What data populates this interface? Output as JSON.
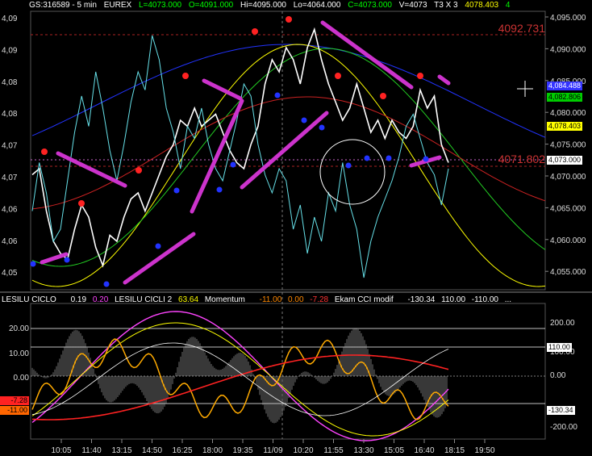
{
  "header": {
    "symbol": "GS:316589 - 5 min",
    "exchange": "EUREX",
    "last": "L=4073.000",
    "open": "O=4091.000",
    "high": "Hi=4095.000",
    "low": "Lo=4064.000",
    "close": "C=4073.000",
    "volume": "V=4073",
    "tx": "T3 X 3",
    "val": "4078.403",
    "num": "4"
  },
  "colors": {
    "up": "#00ff00",
    "hdr_yellow": "#ffff00",
    "price": "#ffffff",
    "cyan": "#66e0e8",
    "magenta": "#cc33cc",
    "accent_red": "#ff2222"
  },
  "price_axis": {
    "left_ticks": [
      "4,09",
      "4,09",
      "4,08",
      "4,08",
      "4,07",
      "4,07",
      "4,06",
      "4,06",
      "4,05"
    ],
    "right_ticks": [
      "4,095.000",
      "4,090.000",
      "4,085.000",
      "4,080.000",
      "4,075.000",
      "4,070.000",
      "4,065.000",
      "4,060.000",
      "4,055.000"
    ]
  },
  "levels": {
    "upper": "4092.731",
    "lower": "4071.802"
  },
  "price_tags": {
    "blue": "4,084.488",
    "green": "4,082.806",
    "yellow": "4,078.403",
    "white": "4,073.000"
  },
  "indicator_header": {
    "l1": "LESILU CICLO",
    "v1": "0.19",
    "v2": "0.20",
    "l2": "LESILU CICLI 2",
    "v3": "63.64",
    "l3": "Momentum",
    "v4": "-11.00",
    "v5": "0.00",
    "v6": "-7.28",
    "l4": "Ekam CCI modif",
    "v7": "-130.34",
    "v8": "110.00",
    "v9": "-110.00",
    "dots": "..."
  },
  "indicator_axis": {
    "left_ticks": [
      "20.00",
      "10.00",
      "0.00"
    ],
    "right_ticks": [
      "200.00",
      "100.00",
      "0.00",
      "-200.00"
    ]
  },
  "indicator_tags": {
    "left_red": "-7.28",
    "left_red2": "-11.00",
    "white1": "110.00",
    "white2": "-130.34"
  },
  "time_axis": [
    "10:05",
    "11:40",
    "13:15",
    "14:50",
    "16:25",
    "18:00",
    "19:35",
    "11/09",
    "10:20",
    "11:55",
    "13:30",
    "15:05",
    "16:40",
    "18:15",
    "19:50"
  ],
  "chart_data": {
    "type": "line",
    "title": "GS:316589 - 5 min",
    "x": [
      0,
      1,
      2,
      3,
      4,
      5,
      6,
      7,
      8,
      9,
      10,
      11,
      12,
      13,
      14,
      15,
      16,
      17,
      18,
      19,
      20,
      21,
      22,
      23,
      24,
      25,
      26,
      27,
      28,
      29,
      30,
      31,
      32,
      33,
      34,
      35,
      36,
      37,
      38,
      39,
      40,
      41,
      42,
      43,
      44,
      45,
      46,
      47,
      48,
      49,
      50,
      51,
      52,
      53,
      54,
      55,
      56,
      57,
      58,
      59
    ],
    "series": [
      {
        "name": "price",
        "values": [
          4071,
          4072,
          4065,
          4060,
          4058,
          4057,
          4062,
          4066,
          4064,
          4059,
          4056,
          4061,
          4060,
          4064,
          4067,
          4068,
          4065,
          4068,
          4071,
          4074,
          4076,
          4080,
          4079,
          4082,
          4079,
          4080,
          4081,
          4078,
          4075,
          4073,
          4072,
          4076,
          4079,
          4086,
          4090,
          4088,
          4092,
          4090,
          4086,
          4092,
          4095,
          4090,
          4086,
          4083,
          4080,
          4082,
          4086,
          4082,
          4078,
          4080,
          4077,
          4080,
          4078,
          4077,
          4079,
          4085,
          4082,
          4084,
          4076,
          4073
        ]
      },
      {
        "name": "price_cyan",
        "values": [
          4065,
          4073,
          4068,
          4060,
          4062,
          4070,
          4078,
          4084,
          4079,
          4088,
          4082,
          4075,
          4070,
          4076,
          4083,
          4088,
          4085,
          4094,
          4090,
          4082,
          4078,
          4072,
          4079,
          4077,
          4082,
          4076,
          4072,
          4070,
          4075,
          4080,
          4086,
          4084,
          4076,
          4071,
          4068,
          4072,
          4070,
          4062,
          4066,
          4058,
          4064,
          4060,
          4068,
          4065,
          4073,
          4066,
          4062,
          4054,
          4060,
          4064,
          4067,
          4070,
          4074,
          4079,
          4081,
          4077,
          4073,
          4071,
          4066,
          4072
        ]
      }
    ],
    "ylim": [
      4052,
      4098
    ],
    "ylabel": "",
    "xlabel": "",
    "grid": false
  }
}
